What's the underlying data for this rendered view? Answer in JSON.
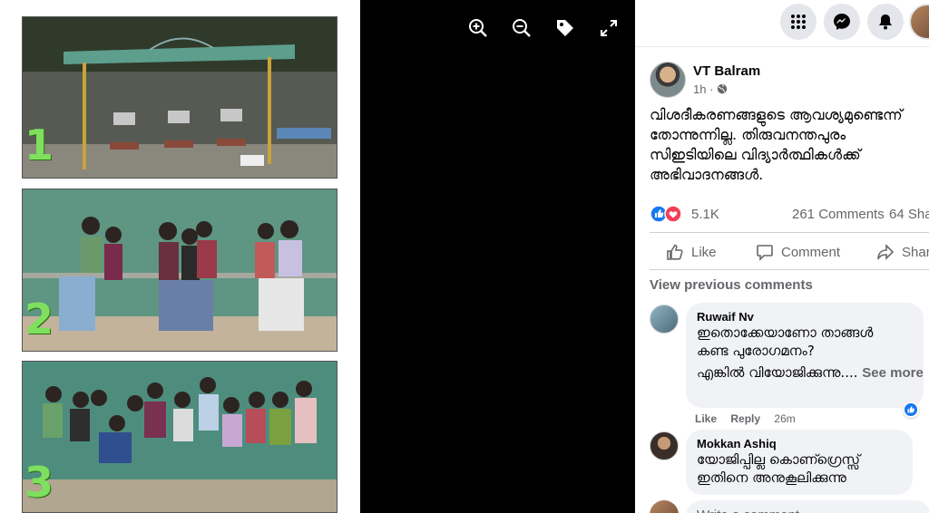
{
  "viewer": {
    "panels": [
      {
        "number": "1"
      },
      {
        "number": "2"
      },
      {
        "number": "3"
      }
    ],
    "toolbar": {
      "icons": [
        "zoom-in-icon",
        "zoom-out-icon",
        "tag-icon",
        "fullscreen-icon"
      ]
    }
  },
  "topbar": {
    "icons": [
      "menu-grid-icon",
      "messenger-icon",
      "notifications-icon",
      "profile-avatar"
    ]
  },
  "post": {
    "author": "VT Balram",
    "time": "1h · ",
    "text": "വിശദീകരണങ്ങളുടെ ആവശ്യമുണ്ടെന്ന് തോന്നുന്നില്ല. തിരുവനന്തപുരം സിഇടിയിലെ വിദ്യാർത്ഥികൾക്ക് അഭിവാദനങ്ങൾ.",
    "reaction_count": "5.1K",
    "comments_count": "261 Comments",
    "shares_count": "64 Sha",
    "actions": {
      "like": "Like",
      "comment": "Comment",
      "share": "Share"
    },
    "view_previous": "View previous comments"
  },
  "comments": [
    {
      "name": "Ruwaif Nv",
      "line1": "ഇതൊക്കേയാണോ താങ്ങൾ",
      "line2": "കണ്ട പുരോഗമനം?",
      "line3": "എങ്കിൽ വിയോജിക്കുന്നു....",
      "see_more": "See more",
      "like": "Like",
      "reply": "Reply",
      "time": "26m"
    },
    {
      "name": "Mokkan Ashiq",
      "line1": "യോജിപ്പില്ല കൊണ്ഗ്രെസ്സ്",
      "line2": "ഇതിനെ അനുകൂലിക്കുന്നു"
    }
  ],
  "write_comment": {
    "placeholder": "Write a comment..."
  },
  "colors": {
    "accent": "#1877f2",
    "love": "#f33e58",
    "panel_numeral": "#7ee05e"
  }
}
